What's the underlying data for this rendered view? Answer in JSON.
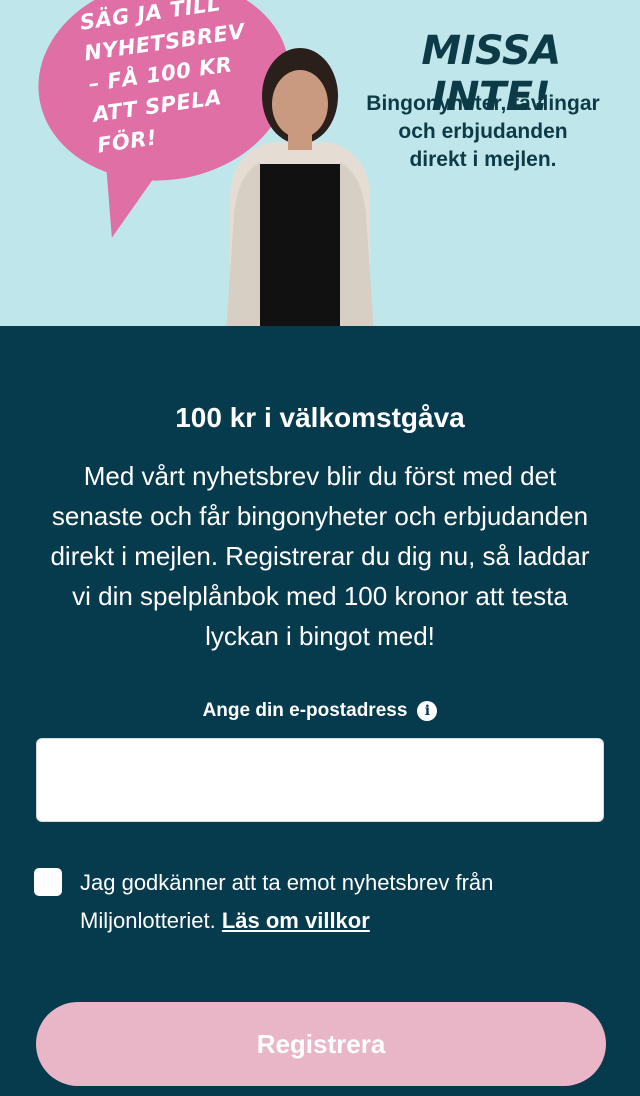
{
  "hero": {
    "bubble_text": "SÄG JA TILL\nNYHETSBREV\n– FÅ 100 KR\nATT SPELA FÖR!",
    "headline": "MISSA INTE!",
    "subheadline": "Bingonyheter, tävlingar\noch erbjudanden\ndirekt i mejlen."
  },
  "main": {
    "title": "100 kr i välkomstgåva",
    "body": "Med vårt nyhetsbrev blir du först med det senaste och får bingonyheter och erbjudanden direkt i mejlen. Registrerar du dig nu, så laddar vi din spelplånbok med 100 kronor att testa lyckan i bingot med!"
  },
  "form": {
    "email_label": "Ange din e-postadress",
    "email_value": "",
    "info_icon": "i",
    "consent_text": "Jag godkänner att ta emot nyhetsbrev från Miljonlotteriet.",
    "consent_link": "Läs om villkor",
    "consent_checked": false,
    "register_label": "Registrera"
  }
}
